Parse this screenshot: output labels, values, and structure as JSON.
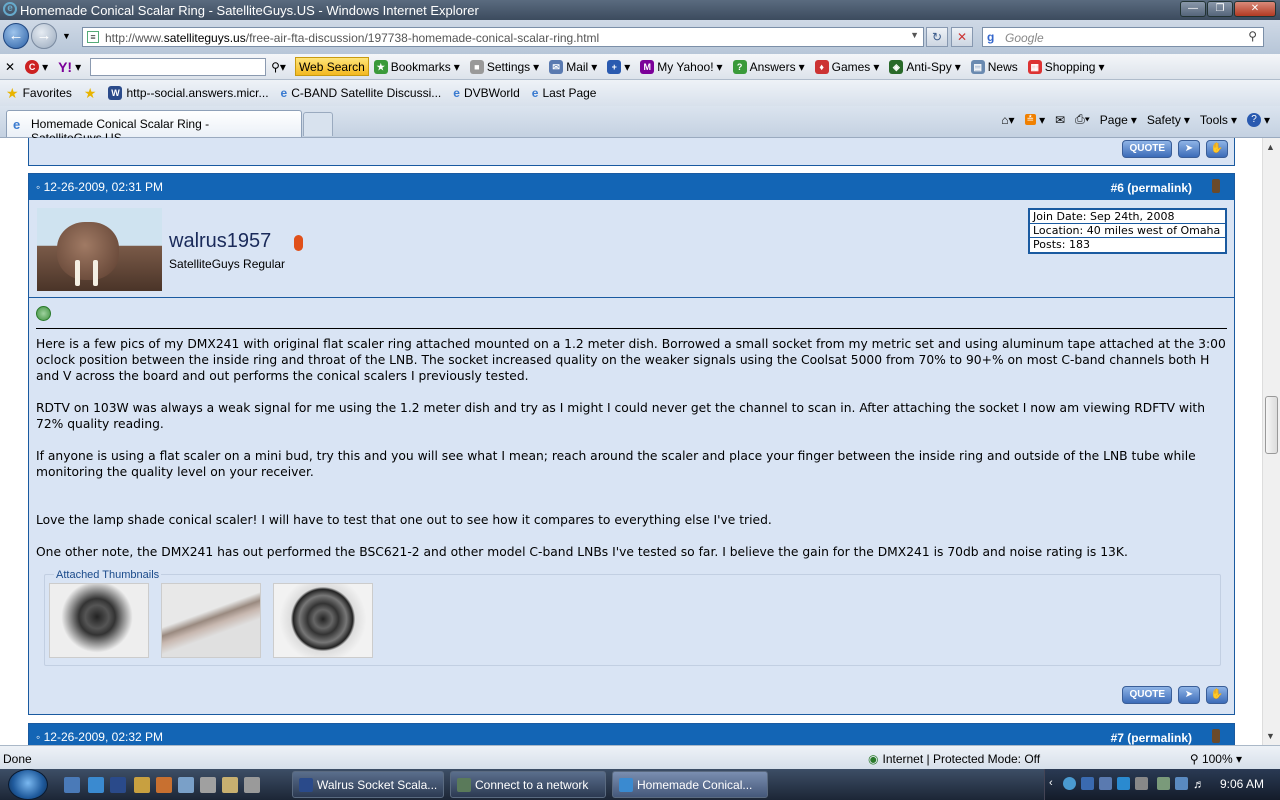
{
  "window": {
    "title": "Homemade Conical Scalar Ring - SatelliteGuys.US - Windows Internet Explorer"
  },
  "address_bar": {
    "url_prefix": "http://www.",
    "url_domain": "satelliteguys.us",
    "url_path": "/free-air-fta-discussion/197738-homemade-conical-scalar-ring.html"
  },
  "search_box": {
    "placeholder": "Google"
  },
  "yahoo_toolbar": {
    "web_search_label": "Web Search",
    "items": [
      "Bookmarks",
      "Settings",
      "Mail",
      "My Yahoo!",
      "Answers",
      "Games",
      "Anti-Spy",
      "News",
      "Shopping"
    ]
  },
  "favorites_bar": {
    "favorites_label": "Favorites",
    "links": [
      "http--social.answers.micr...",
      "C-BAND Satellite Discussi...",
      "DVBWorld",
      "Last Page"
    ]
  },
  "tab": {
    "label": "Homemade Conical Scalar Ring - SatelliteGuys.US"
  },
  "command_bar": {
    "page": "Page",
    "safety": "Safety",
    "tools": "Tools"
  },
  "post": {
    "date": "12-26-2009, 02:31 PM",
    "number": "#6 (permalink)",
    "username": "walrus1957",
    "user_title": "SatelliteGuys Regular",
    "join_date": "Join Date: Sep 24th, 2008",
    "location": "Location: 40 miles west of Omaha",
    "posts": "Posts: 183",
    "paragraphs": [
      "Here is a few pics of my DMX241 with original flat scaler ring attached mounted on a 1.2 meter dish. Borrowed a small socket from my metric set and using aluminum tape attached at the 3:00 oclock position between the inside ring and throat of the LNB. The socket increased quality on the weaker signals using the Coolsat 5000 from 70% to 90+% on most C-band channels both H and V across the board and out performs the conical scalers I previously tested.",
      "RDTV on 103W was always a weak signal for me using the 1.2 meter dish and try as I might I could never get the channel to scan in. After attaching the socket I now am viewing RDFTV with 72% quality reading.",
      "If anyone is using a flat scaler on a mini bud, try this and you will see what I mean; reach around the scaler and place your finger between the inside ring and outside of the LNB tube while monitoring the quality level on your receiver.",
      "Love the lamp shade conical scaler! I will have to test that one out to see how it compares to everything else I've tried.",
      "One other note, the DMX241 has out performed the BSC621-2 and other model C-band LNBs I've tested so far. I believe the gain for the DMX241 is 70db and noise rating is 13K."
    ],
    "attachments_label": "Attached Thumbnails",
    "quote_label": "QUOTE"
  },
  "next_post": {
    "date": "12-26-2009, 02:32 PM",
    "number": "#7 (permalink)"
  },
  "statusbar": {
    "status": "Done",
    "zone": "Internet | Protected Mode: Off",
    "zoom": "100%"
  },
  "taskbar": {
    "tasks": [
      "Walrus Socket Scala...",
      "Connect to a network",
      "Homemade Conical..."
    ],
    "clock": "9:06 AM"
  }
}
